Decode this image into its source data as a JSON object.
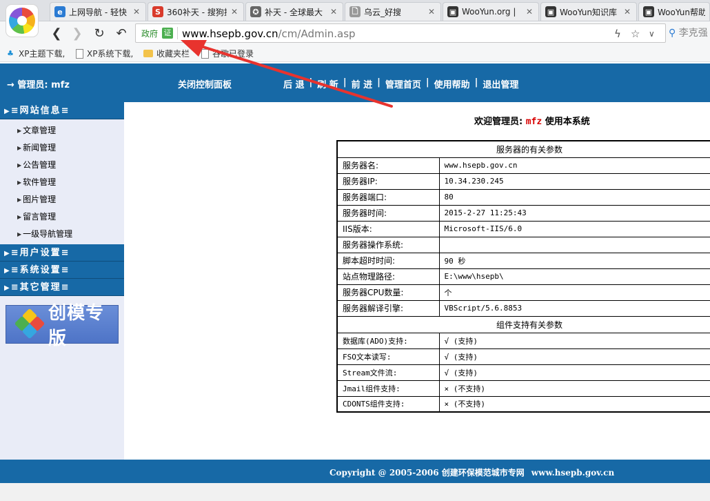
{
  "browser": {
    "tabs": [
      {
        "label": "上网导航 - 轻快",
        "fav": "e",
        "color": "#2b7bd3"
      },
      {
        "label": "360补天 - 搜狗搜",
        "fav": "S",
        "color": "#d93a2b"
      },
      {
        "label": "补天 - 全球最大",
        "fav": "✪",
        "color": "#666666"
      },
      {
        "label": "乌云_好搜",
        "fav": "🗋",
        "color": "#999999"
      },
      {
        "label": "WooYun.org |",
        "fav": "▣",
        "color": "#333333"
      },
      {
        "label": "WooYun知识库",
        "fav": "▣",
        "color": "#333333"
      },
      {
        "label": "WooYun帮助力",
        "fav": "▣",
        "color": "#333333"
      }
    ],
    "tab_close": "✕",
    "address": {
      "gov_label": "政府",
      "cert_label": "证",
      "host": "www.hsepb.gov.cn",
      "path": "/cm/Admin.asp"
    },
    "search_hint": "李克强",
    "bookmarks": [
      {
        "label": "XP主题下载,",
        "icon": "qq"
      },
      {
        "label": "XP系统下载,",
        "icon": "doc"
      },
      {
        "label": "收藏夹栏",
        "icon": "folder"
      },
      {
        "label": "谷歌已登录",
        "icon": "doc"
      }
    ]
  },
  "topbar": {
    "admin_label": "→ 管理员: mfz",
    "close_panel": "关闭控制面板",
    "nav": [
      "后 退",
      "刷 新",
      "前 进",
      "管理首页",
      "使用帮助",
      "退出管理"
    ],
    "separator": "|"
  },
  "sidebar": {
    "sections": [
      {
        "title": "≡网站信息≡",
        "items": [
          "文章管理",
          "新闻管理",
          "公告管理",
          "软件管理",
          "图片管理",
          "留言管理",
          "一级导航管理"
        ]
      },
      {
        "title": "≡用户设置≡",
        "items": []
      },
      {
        "title": "≡系统设置≡",
        "items": []
      },
      {
        "title": "≡其它管理≡",
        "items": []
      }
    ],
    "brand_text": "创模专版"
  },
  "welcome": {
    "prefix": "欢迎管理员:",
    "user": "mfz",
    "suffix": "使用本系统"
  },
  "server_info": {
    "heading": "服务器的有关参数",
    "rows": [
      {
        "k": "服务器名:",
        "v": "www.hsepb.gov.cn"
      },
      {
        "k": "服务器IP:",
        "v": "10.34.230.245"
      },
      {
        "k": "服务器端口:",
        "v": "80"
      },
      {
        "k": "服务器时间:",
        "v": "2015-2-27 11:25:43"
      },
      {
        "k": "IIS版本:",
        "v": "Microsoft-IIS/6.0"
      },
      {
        "k": "服务器操作系统:",
        "v": ""
      },
      {
        "k": "脚本超时时间:",
        "v": "90 秒"
      },
      {
        "k": "站点物理路径:",
        "v": "E:\\www\\hsepb\\"
      },
      {
        "k": "服务器CPU数量:",
        "v": "个"
      },
      {
        "k": "服务器解译引擎:",
        "v": "VBScript/5.6.8853"
      }
    ]
  },
  "component_info": {
    "heading": "组件支持有关参数",
    "rows": [
      {
        "k": "数据库(ADO)支持:",
        "v": "√ (支持)"
      },
      {
        "k": "FSO文本读写:",
        "v": "√ (支持)"
      },
      {
        "k": "Stream文件流:",
        "v": "√ (支持)"
      },
      {
        "k": "Jmail组件支持:",
        "v": "× (不支持)"
      },
      {
        "k": "CDONTS组件支持:",
        "v": "× (不支持)"
      }
    ]
  },
  "footer": {
    "copyright": "Copyright @ 2005-2006 创建环保模范城市专网",
    "site": "www.hsepb.gov.cn"
  },
  "colors": {
    "theme_blue": "#1769a6",
    "annotation_red": "#e8332e",
    "welcome_user_red": "#d80000"
  }
}
